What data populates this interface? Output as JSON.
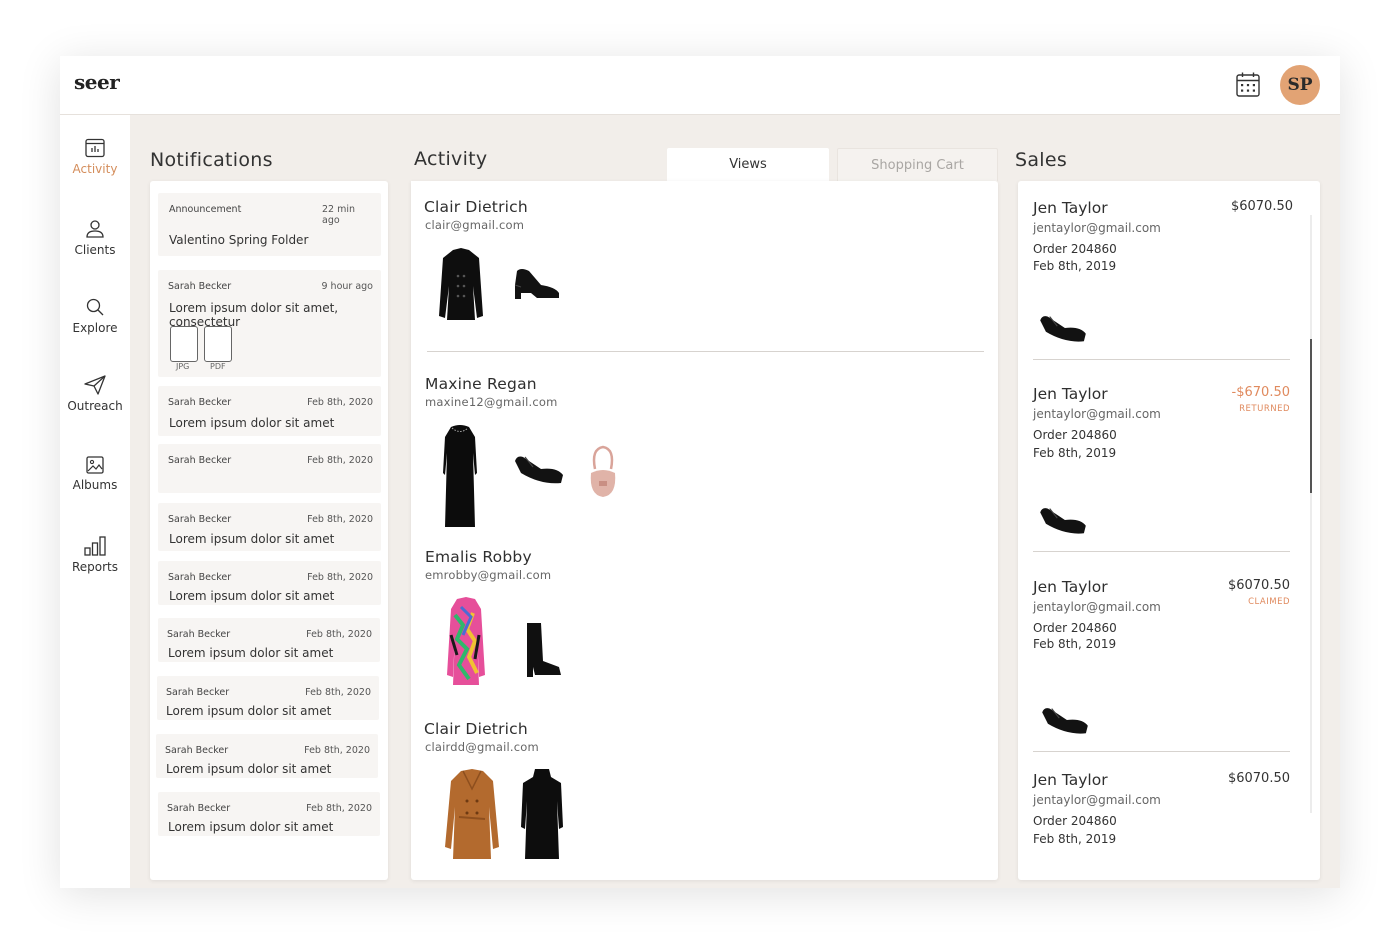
{
  "app": {
    "logo": "seer",
    "avatar_initials": "SP"
  },
  "colors": {
    "accent": "#d48d5b",
    "avatar": "#e2a374",
    "negative": "#e08a5e",
    "background": "#f2eeea"
  },
  "sidebar": {
    "items": [
      {
        "label": "Activity",
        "icon": "activity-icon",
        "active": true
      },
      {
        "label": "Clients",
        "icon": "person-icon",
        "active": false
      },
      {
        "label": "Explore",
        "icon": "search-icon",
        "active": false
      },
      {
        "label": "Outreach",
        "icon": "paper-plane-icon",
        "active": false
      },
      {
        "label": "Albums",
        "icon": "image-icon",
        "active": false
      },
      {
        "label": "Reports",
        "icon": "bar-chart-icon",
        "active": false
      }
    ]
  },
  "notifications": {
    "title": "Notifications",
    "items": [
      {
        "author": "Announcement",
        "time": "22 min ago",
        "text": "Valentino Spring Folder"
      },
      {
        "author": "Sarah Becker",
        "time": "9 hour ago",
        "text": "Lorem ipsum dolor sit amet, consectetur",
        "attachments": [
          "JPG",
          "PDF"
        ]
      },
      {
        "author": "Sarah Becker",
        "time": "Feb 8th, 2020",
        "text": "Lorem ipsum dolor sit amet"
      },
      {
        "author": "Sarah Becker",
        "time": "Feb 8th, 2020",
        "text": ""
      },
      {
        "author": "Sarah Becker",
        "time": "Feb 8th, 2020",
        "text": "Lorem ipsum dolor sit amet"
      },
      {
        "author": "Sarah Becker",
        "time": "Feb 8th, 2020",
        "text": "Lorem ipsum dolor sit amet"
      },
      {
        "author": "Sarah Becker",
        "time": "Feb 8th, 2020",
        "text": "Lorem ipsum dolor sit amet"
      },
      {
        "author": "Sarah Becker",
        "time": "Feb 8th, 2020",
        "text": "Lorem ipsum dolor sit amet"
      },
      {
        "author": "Sarah Becker",
        "time": "Feb 8th, 2020",
        "text": "Lorem ipsum dolor sit amet"
      },
      {
        "author": "Sarah Becker",
        "time": "Feb 8th, 2020",
        "text": "Lorem ipsum dolor sit amet"
      }
    ]
  },
  "activity": {
    "title": "Activity",
    "tabs": [
      {
        "label": "Views",
        "active": true
      },
      {
        "label": "Shopping Cart",
        "active": false
      }
    ],
    "clients": [
      {
        "name": "Clair Dietrich",
        "email": "clair@gmail.com",
        "items": [
          "black-jacket",
          "black-loafers"
        ]
      },
      {
        "name": "Maxine Regan",
        "email": "maxine12@gmail.com",
        "items": [
          "black-dress",
          "black-flats",
          "pink-bag"
        ]
      },
      {
        "name": "Emalis Robby",
        "email": "emrobby@gmail.com",
        "items": [
          "print-coat",
          "black-boots"
        ]
      },
      {
        "name": "Clair Dietrich",
        "email": "clairdd@gmail.com",
        "items": [
          "camel-coat",
          "black-knit-dress"
        ]
      }
    ]
  },
  "sales": {
    "title": "Sales",
    "items": [
      {
        "name": "Jen Taylor",
        "email": "jentaylor@gmail.com",
        "order": "Order 204860",
        "date": "Feb 8th, 2019",
        "amount": "$6070.50",
        "status": ""
      },
      {
        "name": "Jen Taylor",
        "email": "jentaylor@gmail.com",
        "order": "Order 204860",
        "date": "Feb 8th, 2019",
        "amount": "-$670.50",
        "status": "RETURNED"
      },
      {
        "name": "Jen Taylor",
        "email": "jentaylor@gmail.com",
        "order": "Order 204860",
        "date": "Feb 8th, 2019",
        "amount": "$6070.50",
        "status": "CLAIMED"
      },
      {
        "name": "Jen Taylor",
        "email": "jentaylor@gmail.com",
        "order": "Order 204860",
        "date": "Feb 8th, 2019",
        "amount": "$6070.50",
        "status": ""
      }
    ]
  }
}
